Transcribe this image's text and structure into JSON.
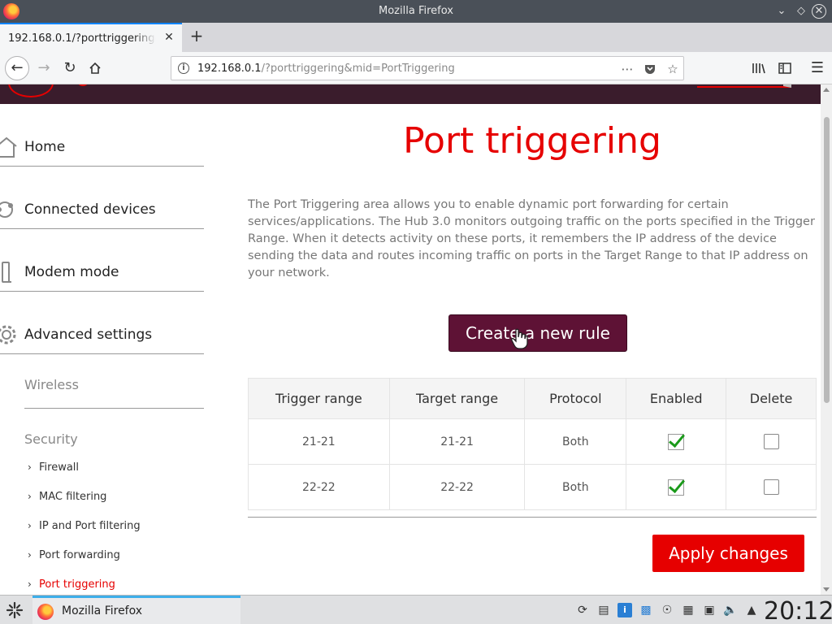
{
  "window": {
    "title": "Mozilla Firefox"
  },
  "tabs": [
    {
      "title": "192.168.0.1/?porttriggering&mid=PortTriggering",
      "active": true
    }
  ],
  "urlbar": {
    "host": "192.168.0.1",
    "path": "/?porttriggering&mid=PortTriggering"
  },
  "sidebar": {
    "items": [
      {
        "label": "Home",
        "icon": "house-icon"
      },
      {
        "label": "Connected devices",
        "icon": "devices-icon"
      },
      {
        "label": "Modem mode",
        "icon": "modem-icon"
      },
      {
        "label": "Advanced settings",
        "icon": "gear-icon"
      }
    ],
    "wireless_heading": "Wireless",
    "security_heading": "Security",
    "security_links": [
      {
        "label": "Firewall",
        "active": false
      },
      {
        "label": "MAC filtering",
        "active": false
      },
      {
        "label": "IP and Port filtering",
        "active": false
      },
      {
        "label": "Port forwarding",
        "active": false
      },
      {
        "label": "Port triggering",
        "active": true
      }
    ]
  },
  "main": {
    "title": "Port triggering",
    "description": "The Port Triggering area allows you to enable dynamic port forwarding for certain services/applications. The Hub 3.0 monitors outgoing traffic on the ports specified in the Trigger Range. When it detects activity on these ports, it remembers the IP address of the device sending the data and routes incoming traffic on ports in the Target Range to that IP address on your network.",
    "create_button": "Create a new rule",
    "apply_button": "Apply changes",
    "table": {
      "headers": [
        "Trigger range",
        "Target range",
        "Protocol",
        "Enabled",
        "Delete"
      ],
      "rows": [
        {
          "trigger": "21-21",
          "target": "21-21",
          "protocol": "Both",
          "enabled": true,
          "delete": false
        },
        {
          "trigger": "22-22",
          "target": "22-22",
          "protocol": "Both",
          "enabled": true,
          "delete": false
        }
      ]
    }
  },
  "taskbar": {
    "task_label": "Mozilla Firefox",
    "clock": "20:12"
  },
  "colors": {
    "brand_red": "#e60000",
    "create_button_bg": "#5e1235",
    "header_bg": "#3a1c2c"
  }
}
